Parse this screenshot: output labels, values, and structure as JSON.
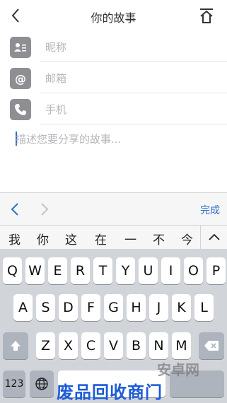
{
  "header": {
    "title": "你的故事",
    "back_icon": "chevron-left-icon",
    "action_icon": "upload-icon"
  },
  "form": {
    "nickname_placeholder": "昵称",
    "email_placeholder": "邮箱",
    "phone_placeholder": "手机",
    "story_placeholder": "描述您要分享的故事..."
  },
  "toolbar": {
    "done_label": "完成"
  },
  "candidates": [
    "我",
    "你",
    "这",
    "在",
    "一",
    "不",
    "今"
  ],
  "keyboard": {
    "row1": [
      "Q",
      "W",
      "E",
      "R",
      "T",
      "Y",
      "U",
      "I",
      "O",
      "P"
    ],
    "row2": [
      "A",
      "S",
      "D",
      "F",
      "G",
      "H",
      "J",
      "K",
      "L"
    ],
    "row3": [
      "Z",
      "X",
      "C",
      "V",
      "B",
      "N",
      "M"
    ],
    "numbers_label": "123"
  },
  "watermark": {
    "bottom": "废品回收商门",
    "side": "安卓网"
  },
  "colors": {
    "accent": "#2f6fc6",
    "icon_gray": "#8e8e93",
    "keyboard_bg": "#d1d4d9"
  }
}
